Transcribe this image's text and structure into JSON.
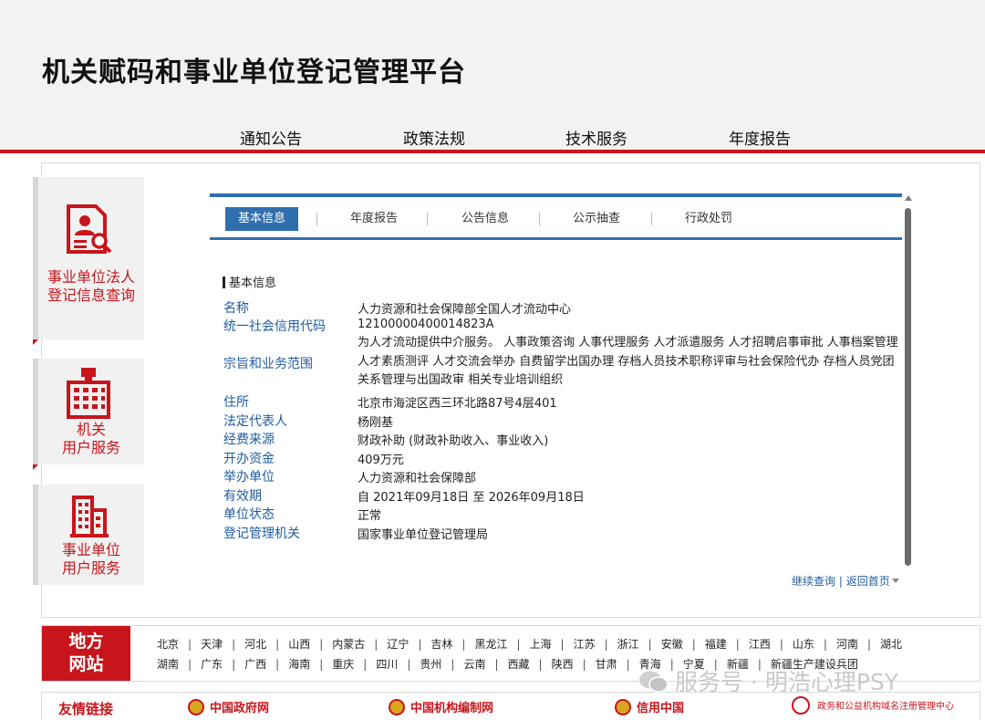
{
  "header": {
    "title": "机关赋码和事业单位登记管理平台",
    "nav": [
      "通知公告",
      "政策法规",
      "技术服务",
      "年度报告"
    ]
  },
  "sidebar": [
    {
      "label": "事业单位法人\n登记信息查询",
      "icon": "person-search-doc-icon"
    },
    {
      "label": "机关\n用户服务",
      "icon": "government-building-icon"
    },
    {
      "label": "事业单位\n用户服务",
      "icon": "office-building-icon"
    }
  ],
  "tabs": [
    "基本信息",
    "年度报告",
    "公告信息",
    "公示抽查",
    "行政处罚"
  ],
  "info": {
    "section_title": "基本信息",
    "rows": [
      {
        "label": "名称",
        "value": "人力资源和社会保障部全国人才流动中心"
      },
      {
        "label": "统一社会信用代码",
        "value": "12100000400014823A"
      },
      {
        "label": "宗旨和业务范围",
        "value": "为人才流动提供中介服务。 人事政策咨询 人事代理服务 人才派遣服务 人才招聘启事审批 人事档案管理 人才素质测评 人才交流会举办 自费留学出国办理 存档人员技术职称评审与社会保险代办 存档人员党团关系管理与出国政审 相关专业培训组织"
      },
      {
        "label": "住所",
        "value": "北京市海淀区西三环北路87号4层401"
      },
      {
        "label": "法定代表人",
        "value": "杨刚基"
      },
      {
        "label": "经费来源",
        "value": "财政补助 (财政补助收入、事业收入)"
      },
      {
        "label": "开办资金",
        "value": "409万元"
      },
      {
        "label": "举办单位",
        "value": "人力资源和社会保障部"
      },
      {
        "label": "有效期",
        "value": "自 2021年09月18日 至 2026年09月18日"
      },
      {
        "label": "单位状态",
        "value": "正常"
      },
      {
        "label": "登记管理机关",
        "value": "国家事业单位登记管理局"
      }
    ]
  },
  "panel_links": {
    "continue": "继续查询",
    "separator": "|",
    "home": "返回首页"
  },
  "regions": {
    "title": "地方\n网站",
    "row1": [
      "北京",
      "天津",
      "河北",
      "山西",
      "内蒙古",
      "辽宁",
      "吉林",
      "黑龙江",
      "上海",
      "江苏",
      "浙江",
      "安徽",
      "福建",
      "江西",
      "山东",
      "河南",
      "湖北"
    ],
    "row2": [
      "湖南",
      "广东",
      "广西",
      "海南",
      "重庆",
      "四川",
      "贵州",
      "云南",
      "西藏",
      "陕西",
      "甘肃",
      "青海",
      "宁夏",
      "新疆",
      "新疆生产建设兵团"
    ]
  },
  "friends": {
    "label": "友情链接",
    "links": [
      "中国政府网",
      "中国机构编制网",
      "信用中国"
    ],
    "small_link": "政务和公益机构域名注册管理中心"
  },
  "watermark": "服务号 · 明浩心理PSY",
  "colors": {
    "brand_red": "#c8151b",
    "tab_blue": "#2f6fae",
    "label_blue": "#1f5ca0"
  }
}
